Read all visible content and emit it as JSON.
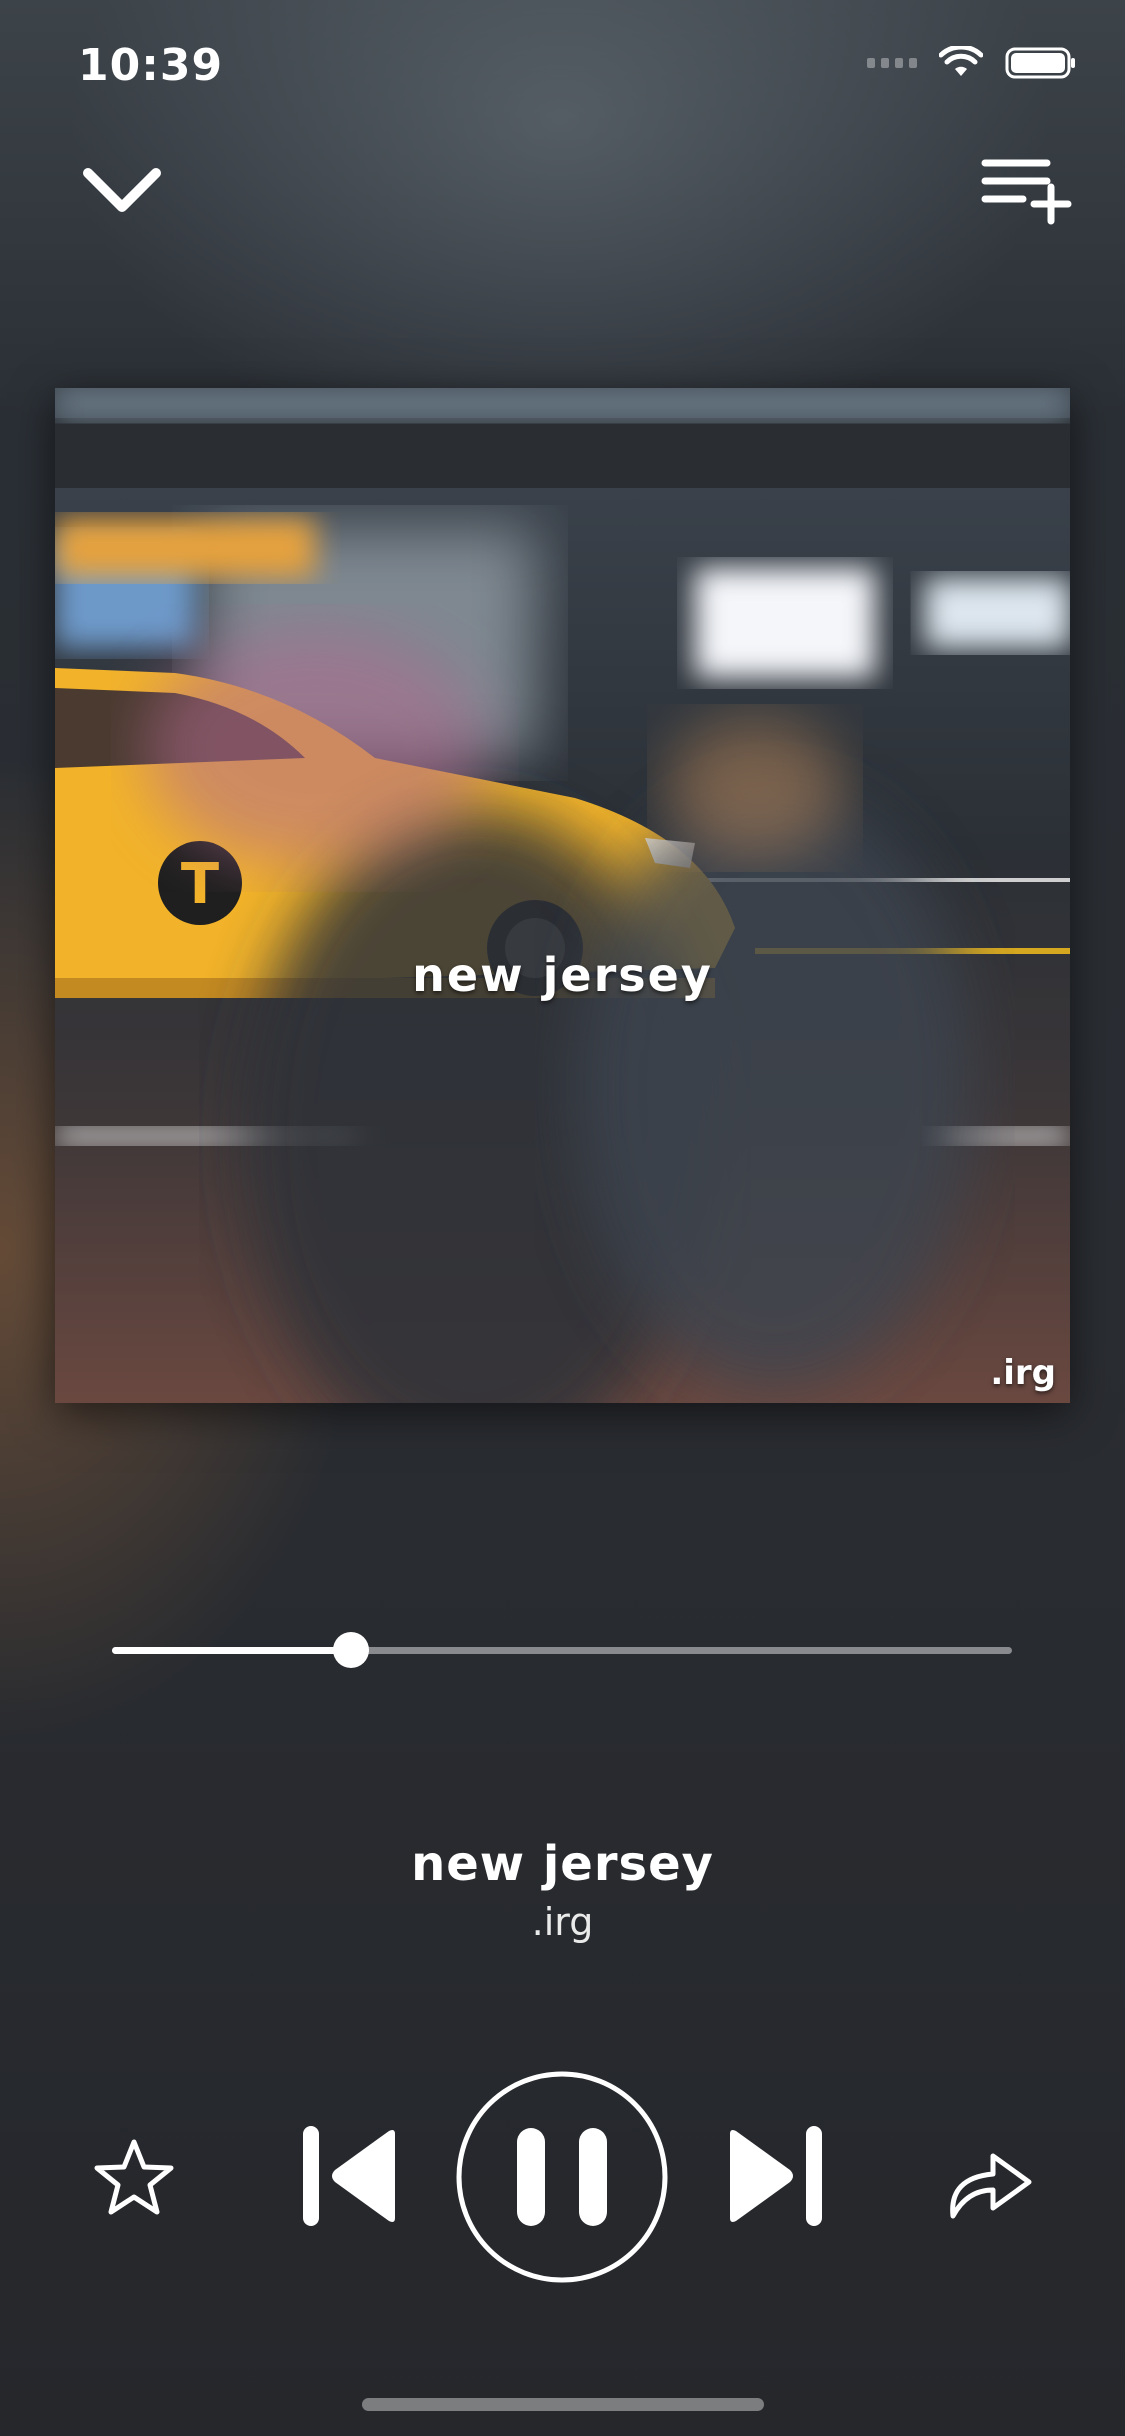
{
  "status_bar": {
    "time": "10:39",
    "icons": [
      "signal-icon",
      "wifi-icon",
      "battery-icon"
    ]
  },
  "header": {
    "collapse_icon": "chevron-down-icon",
    "add_to_queue_icon": "playlist-add-icon"
  },
  "artwork": {
    "title": "new jersey",
    "artist": ".irg"
  },
  "player": {
    "progress": 0.265,
    "track_title": "new jersey",
    "track_artist": ".irg"
  },
  "controls": {
    "favorite_icon": "star-icon",
    "previous_icon": "skip-previous-icon",
    "play_pause_icon": "pause-icon",
    "next_icon": "skip-next-icon",
    "share_icon": "share-icon"
  },
  "colors": {
    "accent": "#ffffff",
    "taxi_yellow": "#f2b32a"
  }
}
